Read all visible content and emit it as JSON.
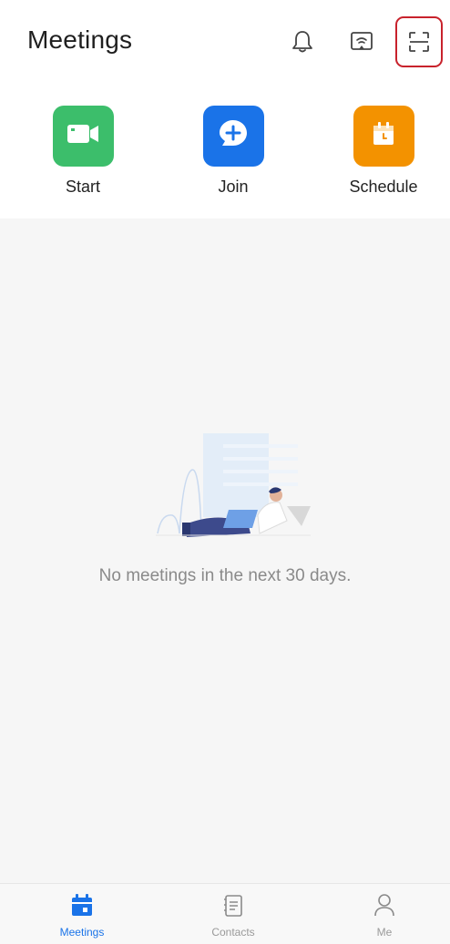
{
  "header": {
    "title": "Meetings",
    "icons": {
      "notifications": "bell-icon",
      "share_screen": "share-screen-icon",
      "scan": "scan-icon"
    }
  },
  "actions": [
    {
      "label": "Start",
      "icon": "video-camera-icon",
      "color": "#3cbe6b"
    },
    {
      "label": "Join",
      "icon": "plus-icon",
      "color": "#1a73e8"
    },
    {
      "label": "Schedule",
      "icon": "calendar-icon",
      "color": "#f39200"
    }
  ],
  "empty_state": {
    "message": "No meetings in the next 30 days."
  },
  "bottom_nav": {
    "items": [
      {
        "label": "Meetings",
        "icon": "calendar-icon",
        "active": true
      },
      {
        "label": "Contacts",
        "icon": "contacts-icon",
        "active": false
      },
      {
        "label": "Me",
        "icon": "person-icon",
        "active": false
      }
    ]
  },
  "colors": {
    "accent": "#1a73e8",
    "highlight": "#c8222c"
  }
}
